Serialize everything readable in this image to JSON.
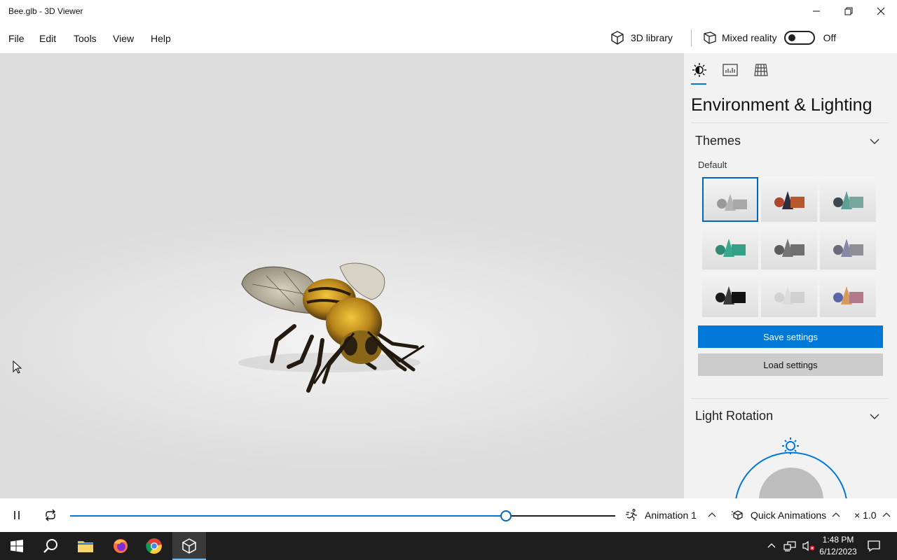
{
  "window": {
    "title": "Bee.glb - 3D Viewer"
  },
  "menu": {
    "file": "File",
    "edit": "Edit",
    "tools": "Tools",
    "view": "View",
    "help": "Help"
  },
  "toolbar": {
    "library_label": "3D library",
    "mixed_reality_label": "Mixed reality",
    "mixed_reality_state": "Off"
  },
  "panel": {
    "heading": "Environment & Lighting",
    "themes_title": "Themes",
    "themes_selected": "Default",
    "save_label": "Save settings",
    "load_label": "Load settings",
    "light_rotation_title": "Light Rotation",
    "tabs": [
      "sun-icon",
      "stats-icon",
      "grid-icon"
    ]
  },
  "animation": {
    "progress": 0.8,
    "animation_label": "Animation 1",
    "quick_label": "Quick Animations",
    "speed_label": "× 1.0"
  },
  "taskbar": {
    "time": "1:48 PM",
    "date": "6/12/2023"
  },
  "colors": {
    "accent": "#0078d7"
  }
}
